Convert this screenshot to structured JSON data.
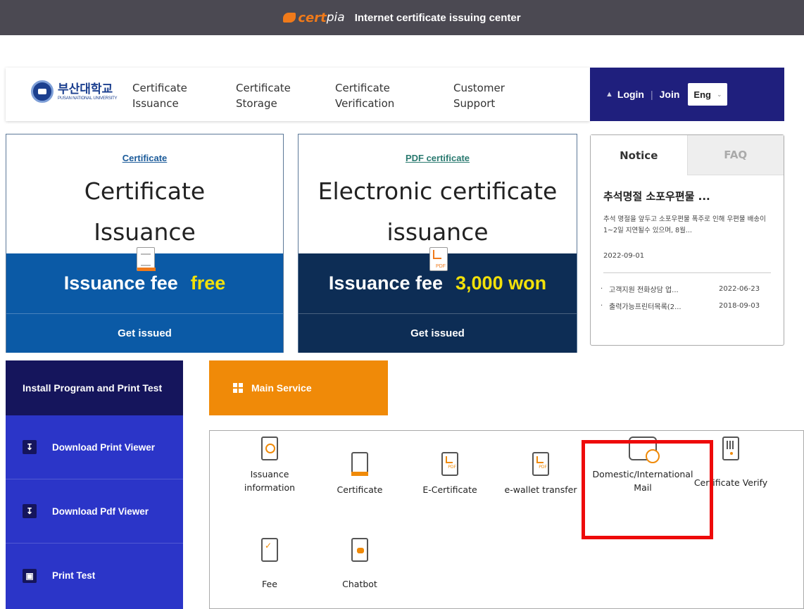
{
  "topbar": {
    "brand_a": "cert",
    "brand_b": "pia",
    "title": "Internet certificate issuing center"
  },
  "university": {
    "name_ko": "부산대학교",
    "name_en": "PUSAN NATIONAL UNIVERSITY"
  },
  "nav": {
    "items": [
      {
        "line1": "Certificate",
        "line2": "Issuance"
      },
      {
        "line1": "Certificate",
        "line2": "Storage"
      },
      {
        "line1": "Certificate",
        "line2": "Verification"
      },
      {
        "line1": "Customer",
        "line2": "Support"
      }
    ]
  },
  "auth": {
    "login": "Login",
    "separator": "|",
    "join": "Join",
    "language": "Eng"
  },
  "cards": [
    {
      "subtitle": "Certificate",
      "title_line1": "Certificate",
      "title_line2": "Issuance",
      "fee_label": "Issuance fee",
      "fee_value": "free",
      "action": "Get issued"
    },
    {
      "subtitle": "PDF certificate",
      "title_line1": "Electronic certificate",
      "title_line2": "issuance",
      "fee_label": "Issuance fee",
      "fee_value": "3,000 won",
      "action": "Get issued"
    }
  ],
  "notice": {
    "tabs": [
      "Notice",
      "FAQ"
    ],
    "headline": "추석명절 소포우편물 ...",
    "body": "추석 명절을 앞두고 소포우편물 폭주로 인해 우편물 배송이 1~2일 지연될수 있으며, 8월...",
    "date": "2022-09-01",
    "items": [
      {
        "title": "고객지원 전화상담 업...",
        "date": "2022-06-23"
      },
      {
        "title": "출력가능프린터목록(2...",
        "date": "2018-09-03"
      }
    ]
  },
  "install": {
    "header": "Install Program and Print Test",
    "items": [
      {
        "icon": "download-icon",
        "label": "Download Print Viewer"
      },
      {
        "icon": "download-icon",
        "label": "Download Pdf Viewer"
      },
      {
        "icon": "printer-icon",
        "label": "Print Test"
      }
    ]
  },
  "main_service": {
    "header": "Main Service",
    "services": [
      {
        "icon": "magnifier-document-icon",
        "line1": "Issuance",
        "line2": "information"
      },
      {
        "icon": "certificate-document-icon",
        "line1": "Certificate",
        "line2": ""
      },
      {
        "icon": "pdf-document-icon",
        "line1": "E-Certificate",
        "line2": ""
      },
      {
        "icon": "pdf-document-icon",
        "line1": "e-wallet transfer",
        "line2": ""
      },
      {
        "icon": "mail-icon",
        "line1": "Domestic/International",
        "line2": "Mail"
      },
      {
        "icon": "qr-phone-icon",
        "line1": "Certificate Verify",
        "line2": ""
      },
      {
        "icon": "fee-checklist-icon",
        "line1": "Fee",
        "line2": ""
      },
      {
        "icon": "chatbot-icon",
        "line1": "Chatbot",
        "line2": ""
      }
    ]
  },
  "colors": {
    "accent_orange": "#f08a08",
    "navy": "#1f1f7d",
    "highlight_red": "#ee0a0a"
  }
}
